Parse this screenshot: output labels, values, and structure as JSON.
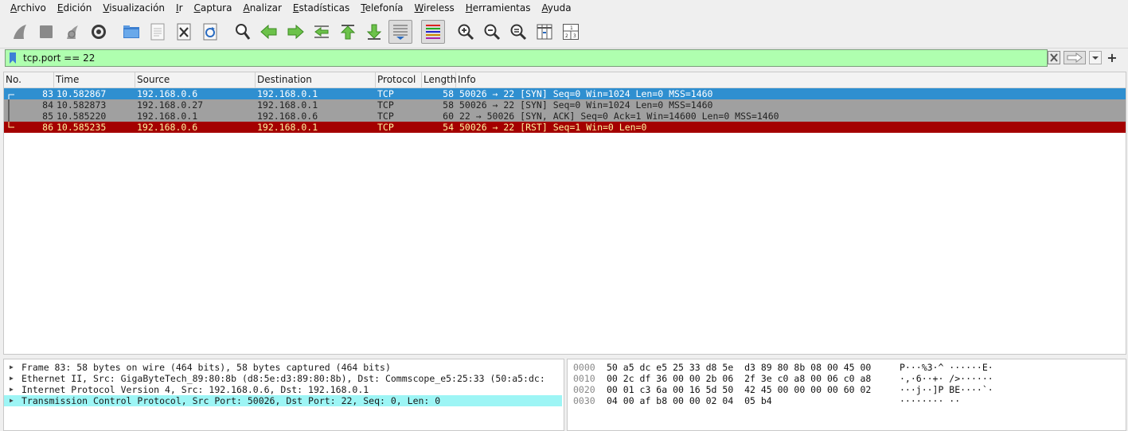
{
  "menu": [
    "Archivo",
    "Edición",
    "Visualización",
    "Ir",
    "Captura",
    "Analizar",
    "Estadísticas",
    "Telefonía",
    "Wireless",
    "Herramientas",
    "Ayuda"
  ],
  "menu_underline": [
    "A",
    "E",
    "V",
    "I",
    "C",
    "A",
    "E",
    "T",
    "W",
    "H",
    "A"
  ],
  "toolbar": [
    {
      "icon": "shark-fin-start-icon"
    },
    {
      "icon": "stop-capture-icon"
    },
    {
      "icon": "restart-capture-icon"
    },
    {
      "icon": "capture-options-gear-icon"
    },
    {
      "sep": true
    },
    {
      "icon": "open-folder-icon"
    },
    {
      "icon": "save-file-icon"
    },
    {
      "icon": "close-file-icon"
    },
    {
      "icon": "reload-file-icon"
    },
    {
      "sep": true
    },
    {
      "icon": "find-packet-icon"
    },
    {
      "icon": "go-back-icon"
    },
    {
      "icon": "go-forward-icon"
    },
    {
      "icon": "go-to-packet-icon"
    },
    {
      "icon": "go-first-icon"
    },
    {
      "icon": "go-last-icon"
    },
    {
      "icon": "auto-scroll-icon",
      "pressed": true
    },
    {
      "sep": true
    },
    {
      "icon": "colorize-icon",
      "pressed": true
    },
    {
      "sep": true
    },
    {
      "icon": "zoom-in-icon"
    },
    {
      "icon": "zoom-out-icon"
    },
    {
      "icon": "zoom-normal-icon"
    },
    {
      "icon": "resize-columns-icon"
    },
    {
      "icon": "layout-panes-icon"
    }
  ],
  "filter": {
    "value": "tcp.port == 22",
    "plus": "+"
  },
  "columns": [
    "No.",
    "Time",
    "Source",
    "Destination",
    "Protocol",
    "Length",
    "Info"
  ],
  "packets": [
    {
      "no": "83",
      "time": "10.582867",
      "src": "192.168.0.6",
      "dst": "192.168.0.1",
      "proto": "TCP",
      "len": "58",
      "info": "50026 → 22 [SYN] Seq=0 Win=1024 Len=0 MSS=1460",
      "bg": "#2f8fd0",
      "fg": "#ffffff",
      "mark": "start"
    },
    {
      "no": "84",
      "time": "10.582873",
      "src": "192.168.0.27",
      "dst": "192.168.0.1",
      "proto": "TCP",
      "len": "58",
      "info": "50026 → 22 [SYN] Seq=0 Win=1024 Len=0 MSS=1460",
      "bg": "#a0a0a0",
      "fg": "#222222",
      "mark": "mid"
    },
    {
      "no": "85",
      "time": "10.585220",
      "src": "192.168.0.1",
      "dst": "192.168.0.6",
      "proto": "TCP",
      "len": "60",
      "info": "22 → 50026 [SYN, ACK] Seq=0 Ack=1 Win=14600 Len=0 MSS=1460",
      "bg": "#a0a0a0",
      "fg": "#222222",
      "mark": "mid"
    },
    {
      "no": "86",
      "time": "10.585235",
      "src": "192.168.0.6",
      "dst": "192.168.0.1",
      "proto": "TCP",
      "len": "54",
      "info": "50026 → 22 [RST] Seq=1 Win=0 Len=0",
      "bg": "#a40000",
      "fg": "#fff5a0",
      "mark": "end"
    }
  ],
  "details": [
    {
      "text": "Frame 83: 58 bytes on wire (464 bits), 58 bytes captured (464 bits)",
      "selected": false
    },
    {
      "text": "Ethernet II, Src: GigaByteTech_89:80:8b (d8:5e:d3:89:80:8b), Dst: Commscope_e5:25:33 (50:a5:dc:",
      "selected": false
    },
    {
      "text": "Internet Protocol Version 4, Src: 192.168.0.6, Dst: 192.168.0.1",
      "selected": false
    },
    {
      "text": "Transmission Control Protocol, Src Port: 50026, Dst Port: 22, Seq: 0, Len: 0",
      "selected": true
    }
  ],
  "hex": [
    {
      "off": "0000",
      "bytes": "50 a5 dc e5 25 33 d8 5e  d3 89 80 8b 08 00 45 00",
      "ascii": "P···%3·^ ······E·"
    },
    {
      "off": "0010",
      "bytes": "00 2c df 36 00 00 2b 06  2f 3e c0 a8 00 06 c0 a8",
      "ascii": "·,·6··+· />······"
    },
    {
      "off": "0020",
      "bytes": "00 01 c3 6a 00 16 5d 50  42 45 00 00 00 00 60 02",
      "ascii": "···j··]P BE····`·"
    },
    {
      "off": "0030",
      "bytes": "04 00 af b8 00 00 02 04  05 b4",
      "ascii": "········ ··"
    }
  ]
}
